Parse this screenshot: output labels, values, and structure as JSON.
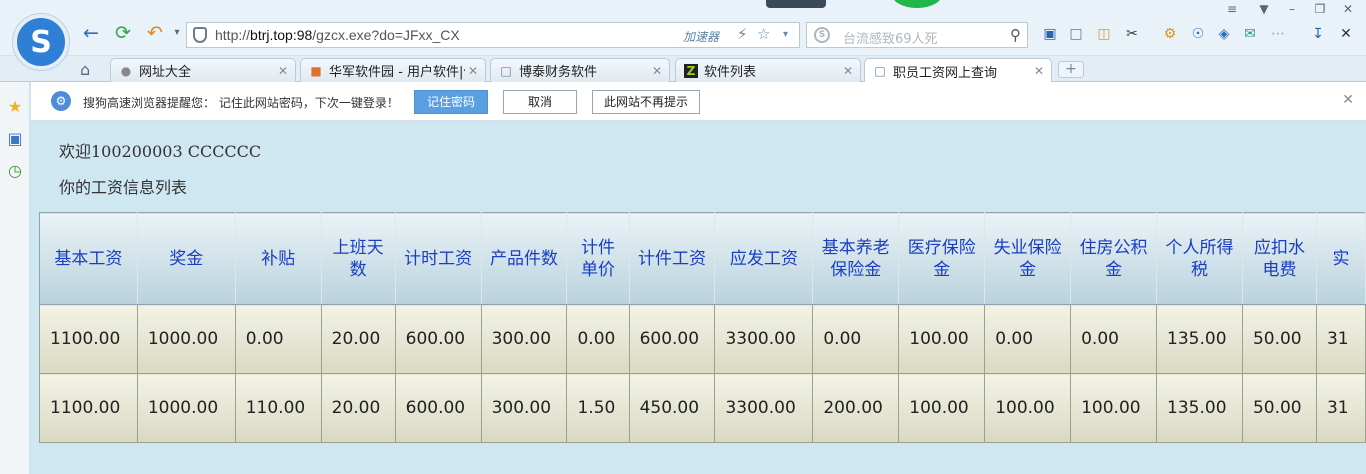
{
  "browser": {
    "url_prefix": "http://",
    "url_host": "btrj.top:98",
    "url_path": "/gzcx.exe?do=JFxx_CX",
    "accelerator_label": "加速器",
    "search_placeholder": "台流感致69人死",
    "logo_letter": "S"
  },
  "tabs": [
    {
      "title": "网址大全",
      "icon": "globe-icon"
    },
    {
      "title": "华军软件园 - 用户软件|作",
      "icon": "huajun-icon"
    },
    {
      "title": "博泰财务软件",
      "icon": "page-icon"
    },
    {
      "title": "软件列表",
      "icon": "z-icon"
    },
    {
      "title": "职员工资网上查询",
      "icon": "page-icon",
      "active": true
    }
  ],
  "notification": {
    "message": "搜狗高速浏览器提醒您： 记住此网站密码，下次一键登录！",
    "remember_label": "记住密码",
    "cancel_label": "取消",
    "never_label": "此网站不再提示"
  },
  "page": {
    "welcome": "欢迎100200003 CCCCCC",
    "list_title": "你的工资信息列表"
  },
  "table": {
    "headers": [
      "基本工资",
      "奖金",
      "补贴",
      "上班天数",
      "计时工资",
      "产品件数",
      "计件单价",
      "计件工资",
      "应发工资",
      "基本养老保险金",
      "医疗保险金",
      "失业保险金",
      "住房公积金",
      "个人所得税",
      "应扣水电费",
      "实"
    ],
    "rows": [
      [
        "1100.00",
        "1000.00",
        "0.00",
        "20.00",
        "600.00",
        "300.00",
        "0.00",
        "600.00",
        "3300.00",
        "0.00",
        "100.00",
        "0.00",
        "0.00",
        "135.00",
        "50.00",
        "31"
      ],
      [
        "1100.00",
        "1000.00",
        "110.00",
        "20.00",
        "600.00",
        "300.00",
        "1.50",
        "450.00",
        "3300.00",
        "200.00",
        "100.00",
        "100.00",
        "100.00",
        "135.00",
        "50.00",
        "31"
      ]
    ]
  }
}
